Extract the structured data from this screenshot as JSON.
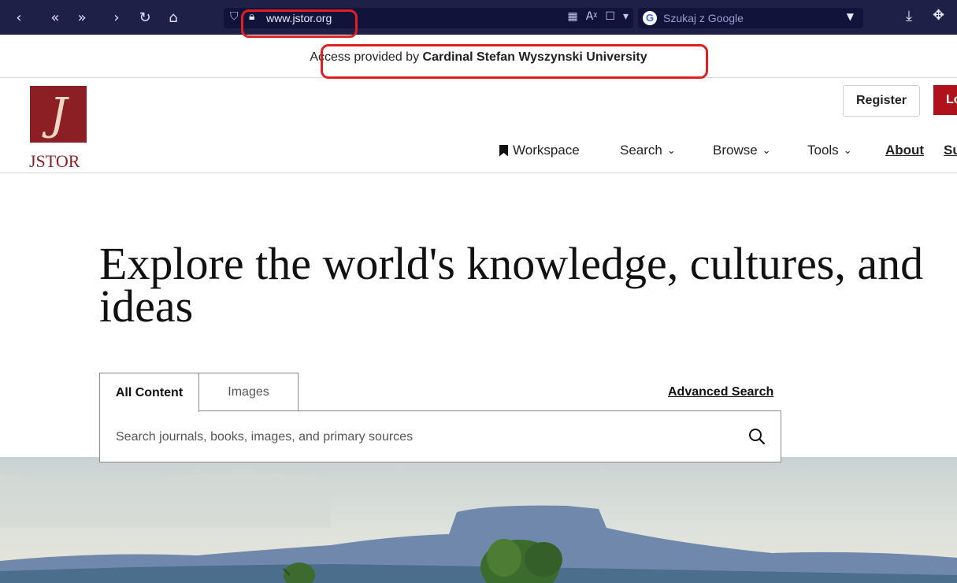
{
  "browser": {
    "nav_icons": [
      "back-icon",
      "rewind-icon",
      "fast-forward-icon",
      "forward-icon",
      "reload-icon",
      "home-icon"
    ],
    "url": "www.jstor.org",
    "search_placeholder": "Szukaj z Google",
    "accent": "#1f2048"
  },
  "access_banner": {
    "prefix": "Access provided by ",
    "institution": "Cardinal Stefan Wyszynski University"
  },
  "header": {
    "logo_text": "JSTOR",
    "register_label": "Register",
    "login_label": "Lo",
    "brand_color": "#8c1f24",
    "nav": {
      "workspace": "Workspace",
      "search": "Search",
      "browse": "Browse",
      "tools": "Tools",
      "about": "About",
      "support": "Su"
    }
  },
  "hero": {
    "title": "Explore the world's knowledge, cultures, and ideas"
  },
  "search": {
    "tab_all": "All Content",
    "tab_images": "Images",
    "advanced": "Advanced Search",
    "placeholder": "Search journals, books, images, and primary sources"
  }
}
